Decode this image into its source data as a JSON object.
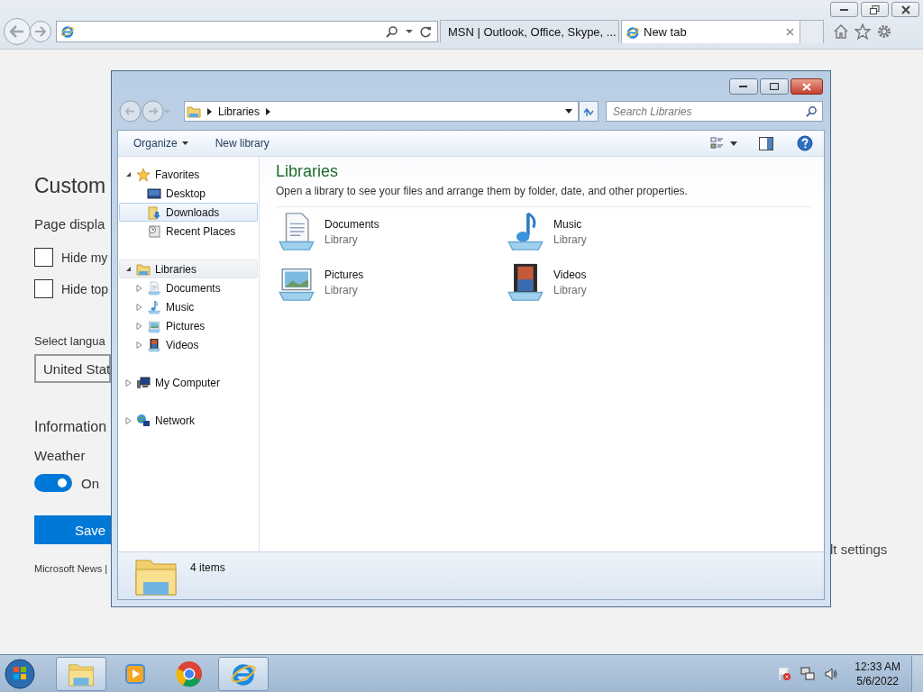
{
  "browser": {
    "tabs": [
      {
        "label": "MSN | Outlook, Office, Skype, ...",
        "selected": false,
        "kind": "msn"
      },
      {
        "label": "New tab",
        "selected": true,
        "kind": "ie"
      }
    ]
  },
  "page": {
    "title": "Custom",
    "section": "Page displa",
    "checkboxes": [
      {
        "label": "Hide my",
        "checked": false
      },
      {
        "label": "Hide top",
        "checked": false
      }
    ],
    "language_label": "Select langua",
    "language_value": "United Stat",
    "info_heading": "Information",
    "weather_label": "Weather",
    "toggle": {
      "on": true,
      "label": "On"
    },
    "save": "Save",
    "footer": "Microsoft News |",
    "right_link": "lt settings"
  },
  "explorer": {
    "breadcrumb": [
      "Libraries"
    ],
    "search": {
      "placeholder": "Search Libraries"
    },
    "toolbar": [
      "Organize",
      "New library"
    ],
    "nav": [
      {
        "label": "Favorites",
        "kind": "star",
        "expanded": true,
        "selected": false,
        "hovered": false,
        "children": [
          {
            "label": "Desktop",
            "kind": "desktop",
            "selected": false,
            "hovered": false
          },
          {
            "label": "Downloads",
            "kind": "downloads",
            "selected": false,
            "hovered": true
          },
          {
            "label": "Recent Places",
            "kind": "recent",
            "selected": false,
            "hovered": false
          }
        ]
      },
      {
        "label": "Libraries",
        "kind": "library",
        "expanded": true,
        "selected": true,
        "hovered": false,
        "children": [
          {
            "label": "Documents",
            "kind": "documents",
            "expanded": false,
            "selected": false,
            "hovered": false
          },
          {
            "label": "Music",
            "kind": "music",
            "expanded": false,
            "selected": false,
            "hovered": false
          },
          {
            "label": "Pictures",
            "kind": "pictures",
            "expanded": false,
            "selected": false,
            "hovered": false
          },
          {
            "label": "Videos",
            "kind": "videos",
            "expanded": false,
            "selected": false,
            "hovered": false
          }
        ]
      },
      {
        "label": "My Computer",
        "kind": "computer",
        "expanded": false,
        "selected": false,
        "hovered": false
      },
      {
        "label": "Network",
        "kind": "network",
        "expanded": false,
        "selected": false,
        "hovered": false
      }
    ],
    "title": "Libraries",
    "description": "Open a library to see your files and arrange them by folder, date, and other properties.",
    "items": [
      {
        "name": "Documents",
        "type": "Library",
        "kind": "documents"
      },
      {
        "name": "Music",
        "type": "Library",
        "kind": "music"
      },
      {
        "name": "Pictures",
        "type": "Library",
        "kind": "pictures"
      },
      {
        "name": "Videos",
        "type": "Library",
        "kind": "videos"
      }
    ],
    "status": "4 items"
  },
  "taskbar": {
    "apps": [
      {
        "kind": "explorer",
        "active": true
      },
      {
        "kind": "media",
        "active": false
      },
      {
        "kind": "chrome",
        "active": false
      },
      {
        "kind": "ie",
        "active": true
      }
    ],
    "time": "12:33 AM",
    "date": "5/6/2022"
  }
}
